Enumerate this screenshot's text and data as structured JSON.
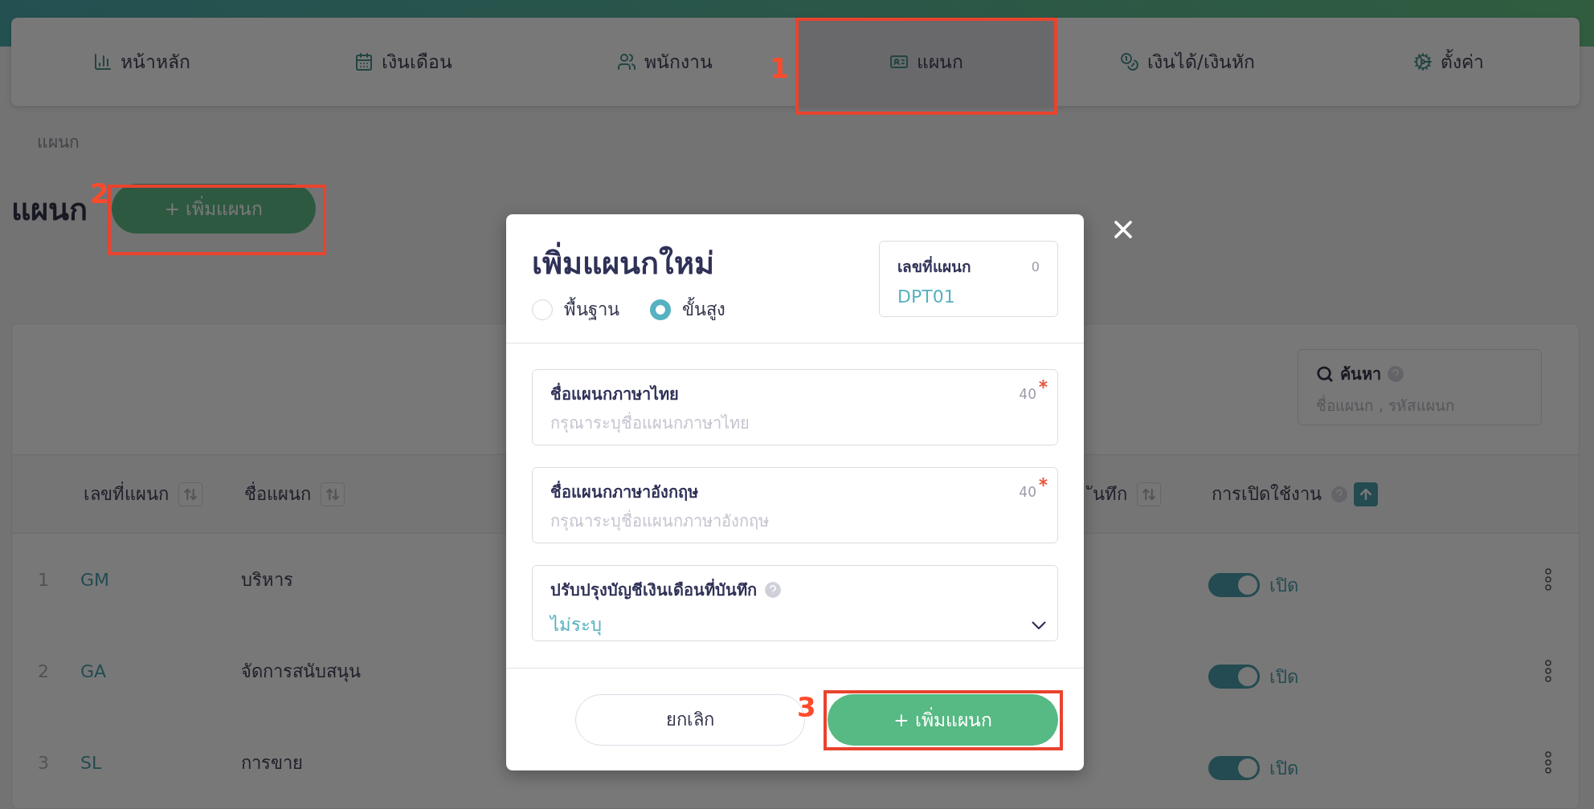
{
  "nav": {
    "tabs": [
      {
        "label": "หน้าหลัก",
        "selected": false
      },
      {
        "label": "เงินเดือน",
        "selected": false
      },
      {
        "label": "พนักงาน",
        "selected": false
      },
      {
        "label": "แผนก",
        "selected": true
      },
      {
        "label": "เงินได้/เงินหัก",
        "selected": false
      },
      {
        "label": "ตั้งค่า",
        "selected": false
      }
    ]
  },
  "breadcrumb": "แผนก",
  "page_title": "แผนก",
  "add_button": "+ เพิ่มแผนก",
  "search": {
    "label": "ค้นหา",
    "placeholder": "ชื่อแผนก , รหัสแผนก",
    "help": true
  },
  "table": {
    "columns": [
      {
        "label": "เลขที่แผนก",
        "sorted": false,
        "help": false
      },
      {
        "label": "ชื่อแผนก",
        "sorted": false,
        "help": false
      },
      {
        "label": "ันทึก",
        "sorted": false,
        "help": false
      },
      {
        "label": "การเปิดใช้งาน",
        "sorted": true,
        "help": true
      }
    ],
    "rows": [
      {
        "index": "1",
        "code": "GM",
        "name": "บริหาร",
        "enabled": true,
        "status": "เปิด"
      },
      {
        "index": "2",
        "code": "GA",
        "name": "จัดการสนับสนุน",
        "enabled": true,
        "status": "เปิด"
      },
      {
        "index": "3",
        "code": "SL",
        "name": "การขาย",
        "enabled": true,
        "status": "เปิด"
      }
    ]
  },
  "modal": {
    "title": "เพิ่มแผนกใหม่",
    "modes": [
      {
        "label": "พื้นฐาน",
        "selected": false
      },
      {
        "label": "ขั้นสูง",
        "selected": true
      }
    ],
    "code_box": {
      "label": "เลขที่แผนก",
      "count": "0",
      "value": "DPT01"
    },
    "fields": [
      {
        "kind": "text",
        "label": "ชื่อแผนกภาษาไทย",
        "limit": "40",
        "required": true,
        "placeholder": "กรุณาระบุชื่อแผนกภาษาไทย"
      },
      {
        "kind": "text",
        "label": "ชื่อแผนกภาษาอังกฤษ",
        "limit": "40",
        "required": true,
        "placeholder": "กรุณาระบุชื่อแผนกภาษาอังกฤษ"
      },
      {
        "kind": "select",
        "label": "ปรับปรุงบัญชีเงินเดือนที่บันทึก",
        "help": true,
        "value": "ไม่ระบุ"
      }
    ],
    "cancel": "ยกเลิก",
    "submit": "+ เพิ่มแผนก"
  },
  "annotations": [
    {
      "label": "1"
    },
    {
      "label": "2"
    },
    {
      "label": "3"
    }
  ]
}
